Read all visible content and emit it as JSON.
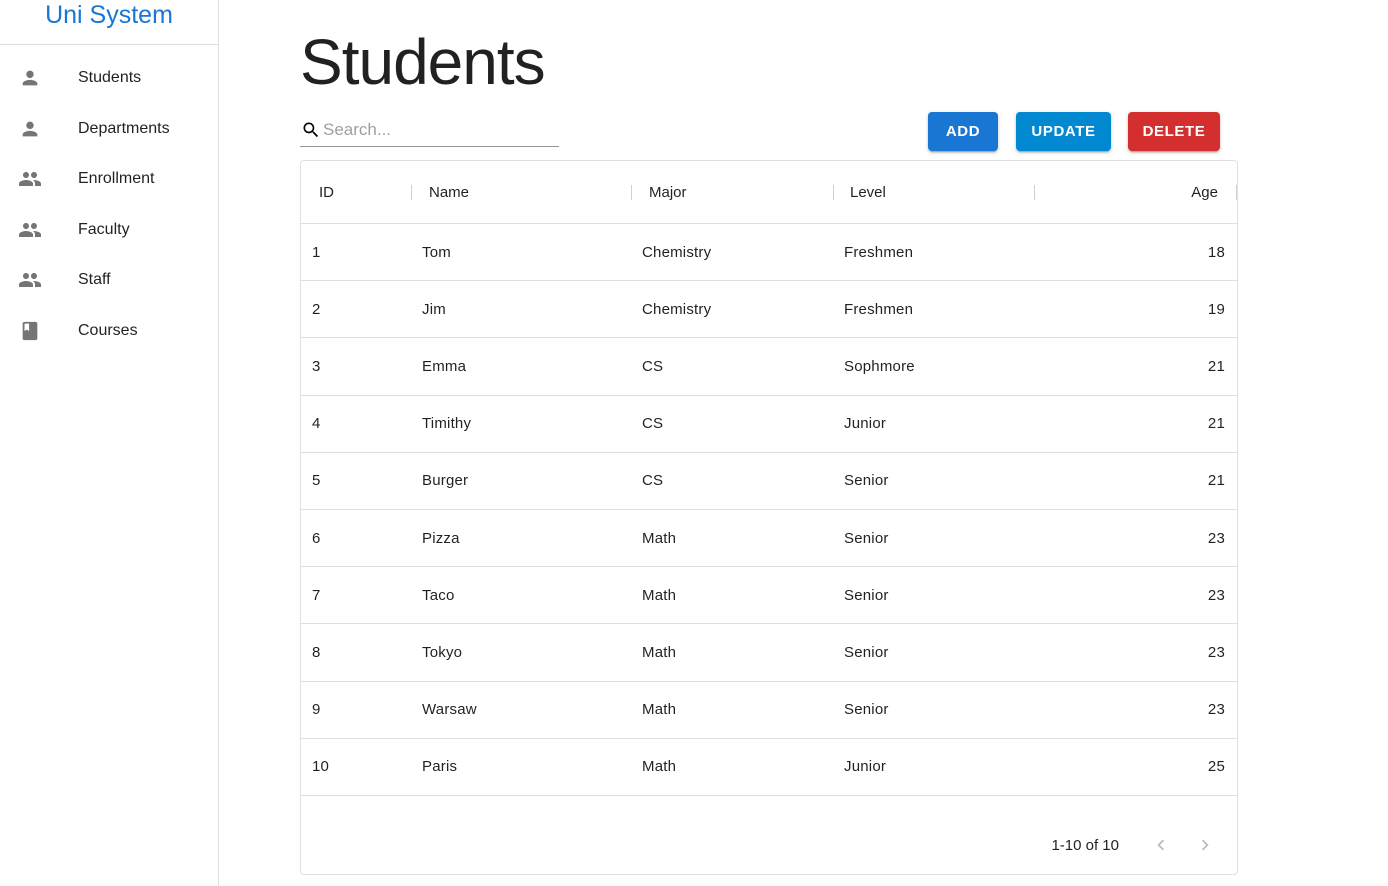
{
  "app": {
    "brand": "Uni System"
  },
  "sidebar": {
    "items": [
      {
        "label": "Students",
        "icon": "person-icon"
      },
      {
        "label": "Departments",
        "icon": "person-icon"
      },
      {
        "label": "Enrollment",
        "icon": "people-icon"
      },
      {
        "label": "Faculty",
        "icon": "people-icon"
      },
      {
        "label": "Staff",
        "icon": "people-icon"
      },
      {
        "label": "Courses",
        "icon": "book-icon"
      }
    ]
  },
  "page": {
    "title": "Students"
  },
  "search": {
    "placeholder": "Search...",
    "value": ""
  },
  "toolbar": {
    "add_label": "ADD",
    "update_label": "UPDATE",
    "delete_label": "DELETE"
  },
  "colors": {
    "primary": "#1976d2",
    "update": "#0288d1",
    "delete": "#d32f2f",
    "icon": "#757575"
  },
  "table": {
    "columns": [
      "ID",
      "Name",
      "Major",
      "Level",
      "Age"
    ],
    "rows": [
      [
        "1",
        "Tom",
        "Chemistry",
        "Freshmen",
        "18"
      ],
      [
        "2",
        "Jim",
        "Chemistry",
        "Freshmen",
        "19"
      ],
      [
        "3",
        "Emma",
        "CS",
        "Sophmore",
        "21"
      ],
      [
        "4",
        "Timithy",
        "CS",
        "Junior",
        "21"
      ],
      [
        "5",
        "Burger",
        "CS",
        "Senior",
        "21"
      ],
      [
        "6",
        "Pizza",
        "Math",
        "Senior",
        "23"
      ],
      [
        "7",
        "Taco",
        "Math",
        "Senior",
        "23"
      ],
      [
        "8",
        "Tokyo",
        "Math",
        "Senior",
        "23"
      ],
      [
        "9",
        "Warsaw",
        "Math",
        "Senior",
        "23"
      ],
      [
        "10",
        "Paris",
        "Math",
        "Junior",
        "25"
      ]
    ]
  },
  "pagination": {
    "label": "1-10 of 10"
  }
}
